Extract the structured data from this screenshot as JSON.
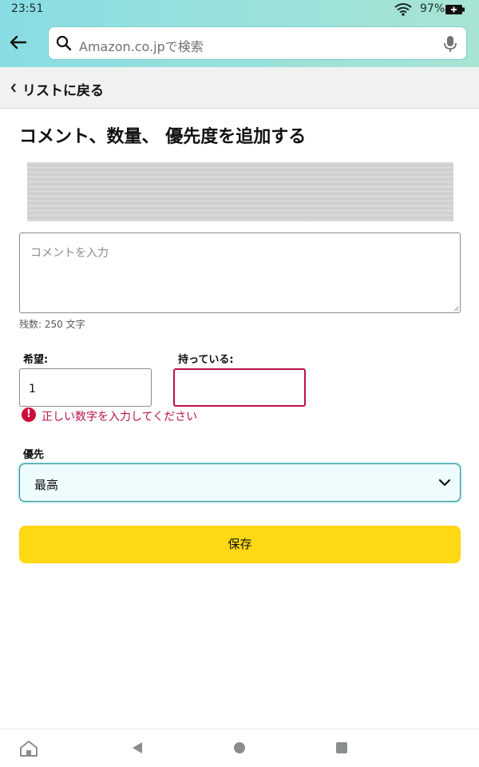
{
  "status_bar": {
    "time": "23:51",
    "battery_percent": "97%",
    "icons": [
      "wifi-icon",
      "battery-charging-icon"
    ]
  },
  "search": {
    "placeholder": "Amazon.co.jpで検索",
    "icons": [
      "back-arrow-icon",
      "search-icon",
      "mic-icon"
    ]
  },
  "back_to_list": {
    "label": "リストに戻る"
  },
  "page": {
    "title": "コメント、数量、 優先度を追加する"
  },
  "comment": {
    "placeholder": "コメントを入力",
    "remaining": "残数: 250 文字"
  },
  "quantity": {
    "want_label": "希望:",
    "want_value": "1",
    "have_label": "持っている:",
    "have_value": "",
    "error_text": "正しい数字を入力してください"
  },
  "priority": {
    "label": "優先",
    "selected": "最高"
  },
  "save_label": "保存",
  "nav_icons": [
    "home-icon",
    "back-triangle-icon",
    "home-circle-icon",
    "recents-square-icon"
  ],
  "colors": {
    "header_gradient_start": "#88dde3",
    "header_gradient_end": "#a8e4d4",
    "save_button": "#ffd814",
    "error": "#b9124e",
    "select_bg": "#eefcfd",
    "select_border": "#278992"
  }
}
